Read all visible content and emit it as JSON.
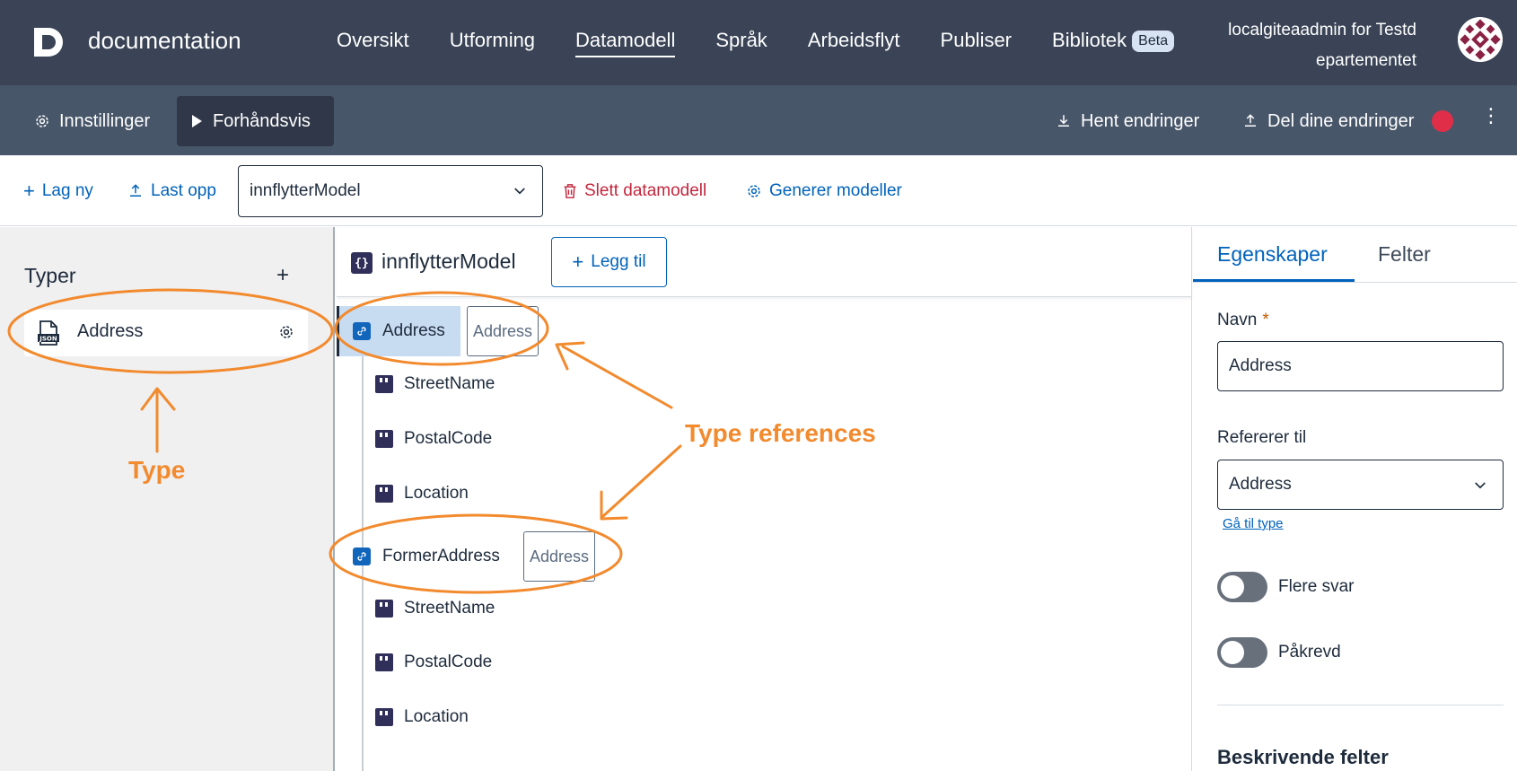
{
  "header": {
    "app_name": "documentation",
    "nav": [
      "Oversikt",
      "Utforming",
      "Datamodell",
      "Språk",
      "Arbeidsflyt",
      "Publiser",
      "Bibliotek"
    ],
    "active_nav": "Datamodell",
    "beta_badge": "Beta",
    "user_line1": "localgiteaadmin for Testd",
    "user_line2": "epartementet"
  },
  "subheader": {
    "settings_label": "Innstillinger",
    "preview_label": "Forhåndsvis",
    "fetch_label": "Hent endringer",
    "share_label": "Del dine endringer",
    "menu_icon": "kebab-icon"
  },
  "toolbar": {
    "new_label": "Lag ny",
    "upload_label": "Last opp",
    "model_select_value": "innflytterModel",
    "delete_label": "Slett datamodell",
    "generate_label": "Generer modeller"
  },
  "types_panel": {
    "title": "Typer",
    "add_symbol": "+",
    "types": [
      {
        "name": "Address",
        "icon": "json-file-icon"
      }
    ]
  },
  "model_panel": {
    "title": "innflytterModel",
    "add_label": "Legg til",
    "nodes": [
      {
        "name": "Address",
        "kind": "reference",
        "ref": "Address",
        "selected": true
      },
      {
        "name": "StreetName",
        "kind": "field"
      },
      {
        "name": "PostalCode",
        "kind": "field"
      },
      {
        "name": "Location",
        "kind": "field"
      },
      {
        "name": "FormerAddress",
        "kind": "reference",
        "ref": "Address",
        "selected": false
      },
      {
        "name": "StreetName",
        "kind": "field"
      },
      {
        "name": "PostalCode",
        "kind": "field"
      },
      {
        "name": "Location",
        "kind": "field"
      }
    ]
  },
  "properties_panel": {
    "tab_properties": "Egenskaper",
    "tab_fields": "Felter",
    "name_label": "Navn",
    "required_marker": "*",
    "name_value": "Address",
    "refers_label": "Refererer til",
    "refers_value": "Address",
    "goto_link": "Gå til type",
    "multiple_label": "Flere svar",
    "required_label": "Påkrevd",
    "descriptive_title": "Beskrivende felter"
  },
  "annotations": {
    "type_label": "Type",
    "type_refs_label": "Type references",
    "color": "#f28a2e"
  },
  "colors": {
    "header_bg": "#3a4456",
    "subheader_bg": "#48566a",
    "accent_blue": "#0062ba",
    "danger_red": "#c2273d",
    "alert_dot": "#e02e49",
    "selected_row": "#c7dcf1"
  }
}
